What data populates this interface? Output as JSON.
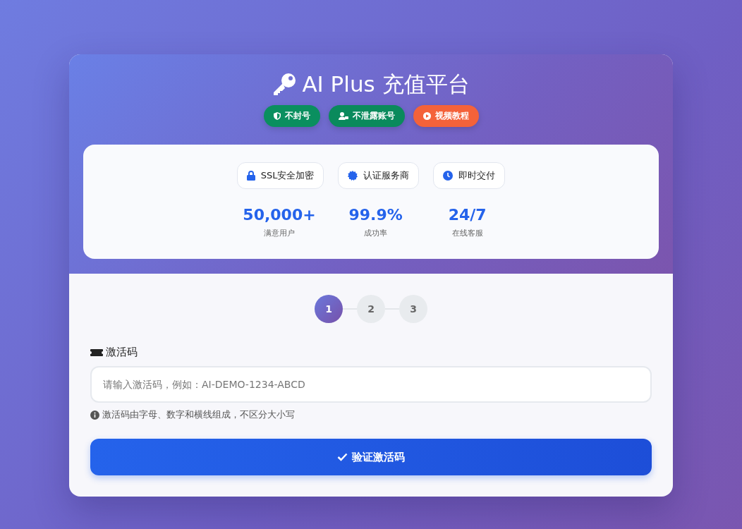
{
  "header": {
    "title": "AI Plus 充值平台",
    "badges": [
      {
        "kind": "shield",
        "label": "不封号",
        "color": "#0a8f5f"
      },
      {
        "kind": "user-lock",
        "label": "不泄露账号",
        "color": "#0a8a5c"
      },
      {
        "kind": "play",
        "label": "视频教程",
        "color": "#f4623a"
      }
    ]
  },
  "features": [
    {
      "kind": "lock",
      "label": "SSL安全加密"
    },
    {
      "kind": "seal",
      "label": "认证服务商"
    },
    {
      "kind": "clock",
      "label": "即时交付"
    }
  ],
  "stats": [
    {
      "value": "50,000+",
      "label": "满意用户"
    },
    {
      "value": "99.9%",
      "label": "成功率"
    },
    {
      "value": "24/7",
      "label": "在线客服"
    }
  ],
  "steps": [
    {
      "label": "1",
      "selected": true
    },
    {
      "label": "2",
      "selected": false
    },
    {
      "label": "3",
      "selected": false
    }
  ],
  "form": {
    "label": "激活码",
    "placeholder": "请输入激活码，例如：AI-DEMO-1234-ABCD",
    "hint": "激活码由字母、数字和横线组成，不区分大小写",
    "submit": "验证激活码"
  }
}
